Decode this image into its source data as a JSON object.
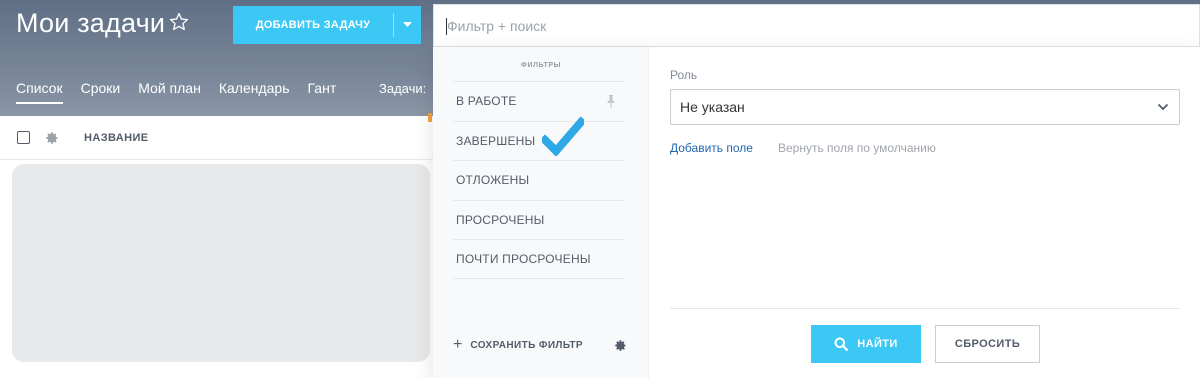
{
  "header": {
    "title": "Мои задачи",
    "add_task_label": "ДОБАВИТЬ ЗАДАЧУ"
  },
  "nav": {
    "tabs": [
      {
        "label": "Список",
        "active": true
      },
      {
        "label": "Сроки",
        "active": false
      },
      {
        "label": "Мой план",
        "active": false
      },
      {
        "label": "Календарь",
        "active": false
      },
      {
        "label": "Гант",
        "active": false
      }
    ],
    "tasks_label": "Задачи:"
  },
  "list": {
    "column_name": "НАЗВАНИЕ"
  },
  "search": {
    "placeholder": "Фильтр + поиск",
    "value": ""
  },
  "filter_popup": {
    "title": "ФИЛЬТРЫ",
    "presets": [
      {
        "label": "В РАБОТЕ",
        "pinned": true
      },
      {
        "label": "ЗАВЕРШЕНЫ",
        "selected": true
      },
      {
        "label": "ОТЛОЖЕНЫ"
      },
      {
        "label": "ПРОСРОЧЕНЫ"
      },
      {
        "label": "ПОЧТИ ПРОСРОЧЕНЫ"
      }
    ],
    "save_filter_label": "СОХРАНИТЬ ФИЛЬТР",
    "role_label": "Роль",
    "role_value": "Не указан",
    "add_field_label": "Добавить поле",
    "reset_fields_label": "Вернуть поля по умолчанию",
    "find_label": "НАЙТИ",
    "reset_label": "СБРОСИТЬ"
  },
  "colors": {
    "accent": "#3bc8f5",
    "link": "#2067b0",
    "checkmark": "#2fa8e6",
    "text_dark": "#535c69"
  },
  "icons": [
    "star-icon",
    "chevron-down-icon",
    "gear-icon",
    "pin-icon",
    "checkmark-icon",
    "plus-icon",
    "search-icon"
  ]
}
